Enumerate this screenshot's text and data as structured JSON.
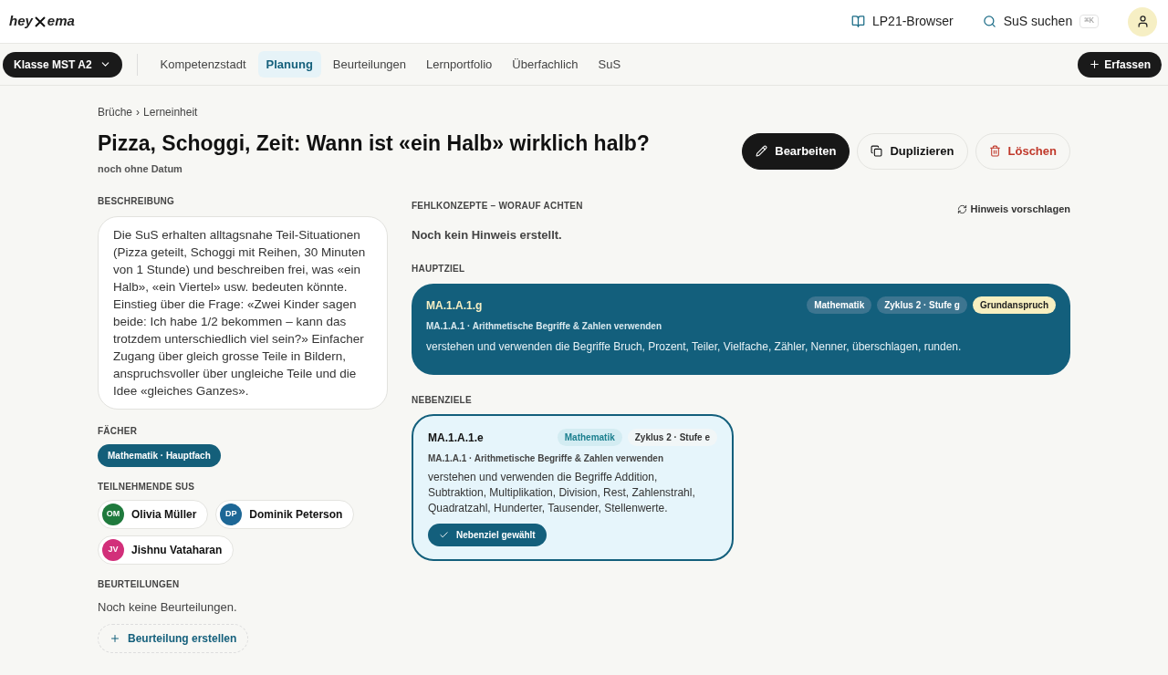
{
  "header": {
    "logo_left": "hey",
    "logo_right": "ema",
    "links": [
      {
        "kind": "book",
        "label": "LP21-Browser"
      },
      {
        "kind": "search",
        "label": "SuS suchen",
        "shortcut": "⌘K"
      }
    ]
  },
  "nav": {
    "class_selector": "Klasse MST A2",
    "tabs": [
      {
        "label": "Kompetenzstadt",
        "selected": false
      },
      {
        "label": "Planung",
        "selected": true
      },
      {
        "label": "Beurteilungen",
        "selected": false
      },
      {
        "label": "Lernportfolio",
        "selected": false
      },
      {
        "label": "Überfachlich",
        "selected": false
      },
      {
        "label": "SuS",
        "selected": false
      }
    ],
    "create_button": "Erfassen"
  },
  "breadcrumb": {
    "items": [
      "Brüche",
      "Lerneinheit"
    ],
    "separator": "›"
  },
  "title": "Pizza, Schoggi, Zeit: Wann ist «ein Halb» wirklich halb?",
  "date": "noch ohne Datum",
  "actions": [
    {
      "kind": "edit",
      "label": "Bearbeiten"
    },
    {
      "kind": "duplicate",
      "label": "Duplizieren"
    },
    {
      "kind": "delete",
      "label": "Löschen"
    }
  ],
  "description": {
    "heading": "BESCHREIBUNG",
    "text": "Die SuS erhalten alltagsnahe Teil-Situationen (Pizza geteilt, Schoggi mit Reihen, 30 Minuten von 1 Stunde) und beschreiben frei, was «ein Halb», «ein Viertel» usw. bedeuten könnte. Einstieg über die Frage: «Zwei Kinder sagen beide: Ich habe 1/2 bekommen – kann das trotzdem unterschiedlich viel sein?» Einfacher Zugang über gleich grosse Teile in Bildern, anspruchsvoller über ungleiche Teile und die Idee «gleiches Ganzes»."
  },
  "subjects": {
    "heading": "FÄCHER",
    "items": [
      "Mathematik · Hauptfach"
    ]
  },
  "students": {
    "heading": "TEILNEHMENDE SUS",
    "items": [
      {
        "initials": "OM",
        "name": "Olivia Müller",
        "color": "#1f7a3d"
      },
      {
        "initials": "DP",
        "name": "Dominik Peterson",
        "color": "#1d6796"
      },
      {
        "initials": "JV",
        "name": "Jishnu Vataharan",
        "color": "#d22f7a"
      }
    ]
  },
  "assessments": {
    "heading": "BEURTEILUNGEN",
    "empty": "Noch keine Beurteilungen.",
    "button": "Beurteilung erstellen"
  },
  "misconceptions": {
    "heading": "FEHLKONZEPTE – WORAUF ACHTEN",
    "action": "Hinweis vorschlagen",
    "empty": "Noch kein Hinweis erstellt."
  },
  "main_goal": {
    "heading": "HAUPTZIEL",
    "code": "MA.1.A.1.g",
    "tags": [
      {
        "kind": "subject",
        "label": "Mathematik"
      },
      {
        "kind": "level",
        "label": "Zyklus 2 · Stufe g"
      },
      {
        "kind": "requirement",
        "label": "Grundanspruch"
      }
    ],
    "competence": "MA.1.A.1 · Arithmetische Begriffe & Zahlen verwenden",
    "text": "verstehen und verwenden die Begriffe Bruch, Prozent, Teiler, Vielfache, Zähler, Nenner, überschlagen, runden."
  },
  "secondary_goals": {
    "heading": "NEBENZIELE",
    "items": [
      {
        "code": "MA.1.A.1.e",
        "tags": [
          {
            "kind": "subject",
            "label": "Mathematik"
          },
          {
            "kind": "level",
            "label": "Zyklus 2 · Stufe e"
          }
        ],
        "competence": "MA.1.A.1 · Arithmetische Begriffe & Zahlen verwenden",
        "text": "verstehen und verwenden die Begriffe Addition, Subtraktion, Multiplikation, Division, Rest, Zahlenstrahl, Quadratzahl, Hunderter, Tausender, Stellenwerte.",
        "selected": true,
        "status": "Nebenziel gewählt"
      }
    ]
  }
}
